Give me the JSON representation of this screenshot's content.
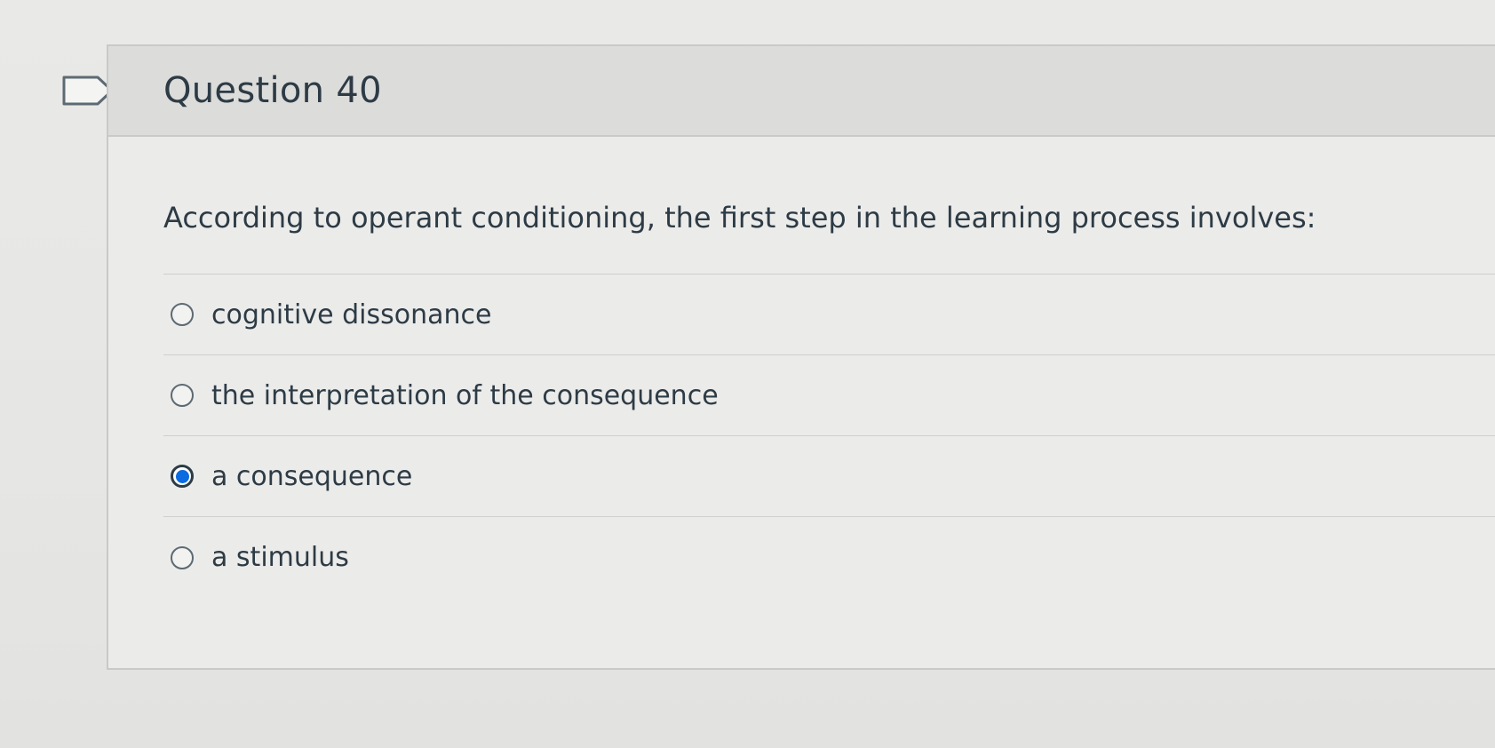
{
  "question": {
    "title": "Question 40",
    "text": "According to operant conditioning, the first step in the learning process involves:",
    "answers": [
      {
        "label": "cognitive dissonance",
        "selected": false
      },
      {
        "label": "the interpretation of the consequence",
        "selected": false
      },
      {
        "label": "a consequence",
        "selected": true
      },
      {
        "label": "a stimulus",
        "selected": false
      }
    ]
  },
  "icons": {
    "flag": "flag-icon"
  },
  "colors": {
    "selected_radio": "#0b6be0",
    "text": "#2d3b45",
    "header_bg": "#dcdcda"
  }
}
